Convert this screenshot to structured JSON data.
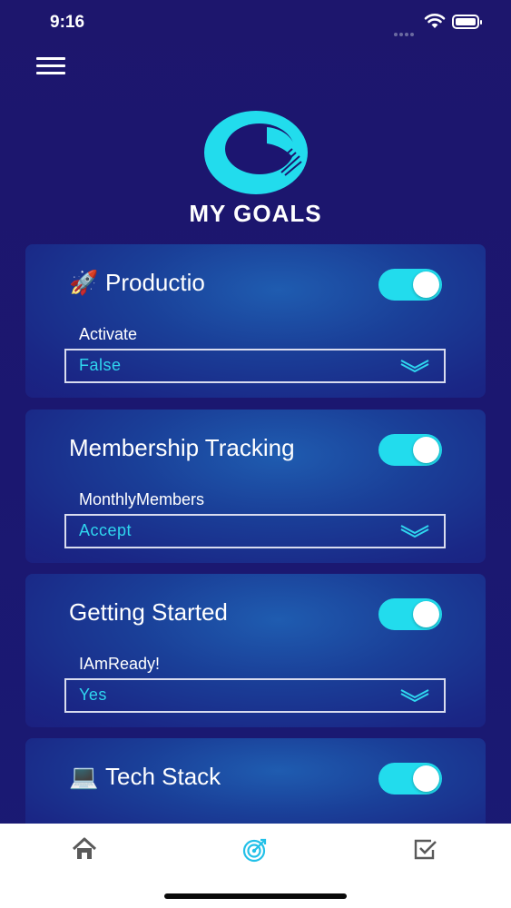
{
  "status_bar": {
    "time": "9:16"
  },
  "header": {
    "title": "MY GOALS"
  },
  "cards": [
    {
      "emoji": "🚀",
      "title": "Productio",
      "toggle_on": true,
      "field_label": "Activate",
      "field_value": "False"
    },
    {
      "emoji": "",
      "title": "Membership Tracking",
      "toggle_on": true,
      "field_label": "MonthlyMembers",
      "field_value": "Accept"
    },
    {
      "emoji": "",
      "title": "Getting Started",
      "toggle_on": true,
      "field_label": "IAmReady!",
      "field_value": "Yes"
    },
    {
      "emoji": "💻",
      "title": "Tech Stack",
      "toggle_on": true,
      "field_label": "",
      "field_value": ""
    }
  ],
  "tab_bar": {
    "tabs": [
      {
        "icon": "home-icon"
      },
      {
        "icon": "target-icon",
        "active": true
      },
      {
        "icon": "checkbox-icon"
      }
    ]
  },
  "colors": {
    "accent": "#22dced",
    "background": "#1c1570",
    "tab_inactive": "#5a5a5a"
  }
}
